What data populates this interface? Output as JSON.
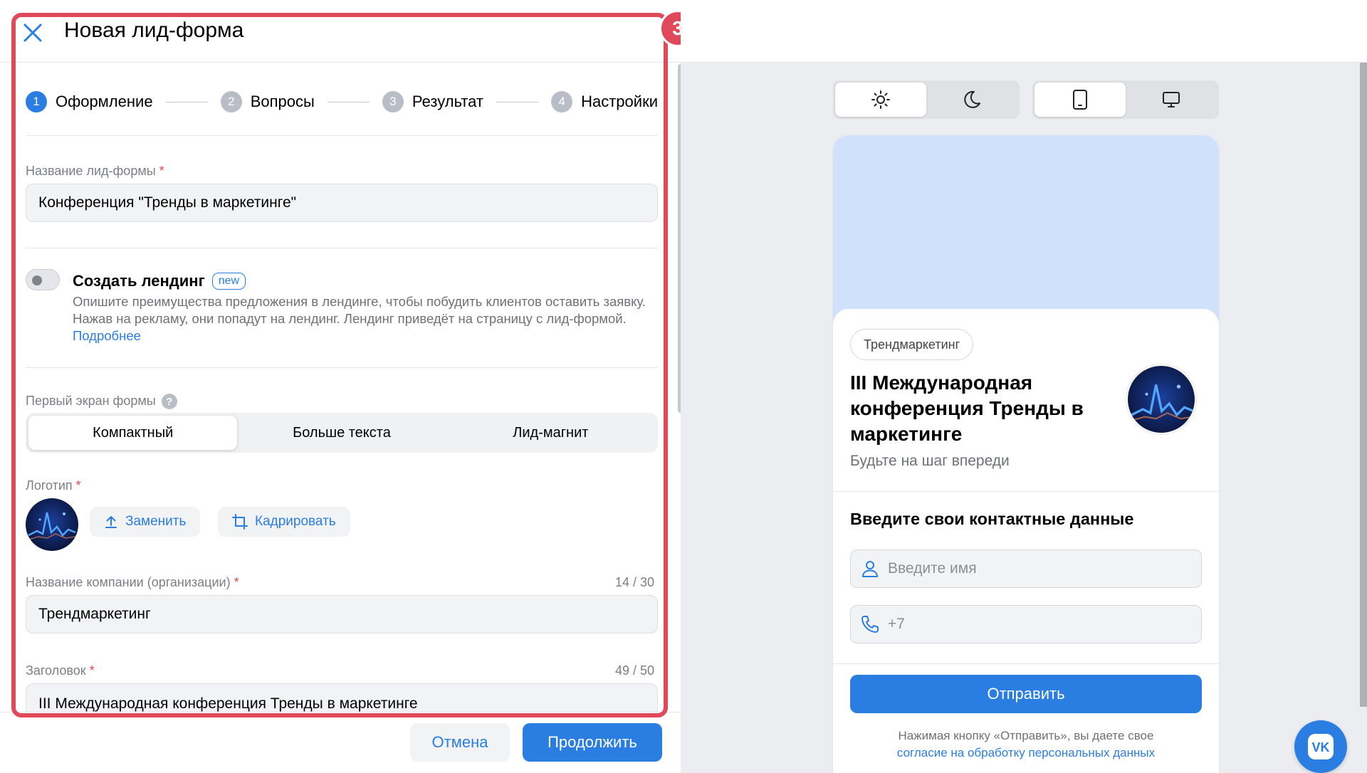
{
  "header": {
    "title": "Новая лид-форма"
  },
  "stepper": {
    "steps": [
      {
        "num": "1",
        "label": "Оформление",
        "active": true
      },
      {
        "num": "2",
        "label": "Вопросы",
        "active": false
      },
      {
        "num": "3",
        "label": "Результат",
        "active": false
      },
      {
        "num": "4",
        "label": "Настройки",
        "active": false
      }
    ]
  },
  "form": {
    "name_label": "Название лид-формы",
    "name_value": "Конференция \"Тренды в маркетинге\"",
    "landing": {
      "title": "Создать лендинг",
      "badge": "new",
      "desc": "Опишите преимущества предложения в лендинге, чтобы побудить клиентов оставить заявку. Нажав на рекламу, они попадут на лендинг. Лендинг приведёт на страницу с лид-формой.",
      "link": "Подробнее"
    },
    "first_screen_label": "Первый экран формы",
    "first_screen_options": [
      "Компактный",
      "Больше текста",
      "Лид-магнит"
    ],
    "first_screen_selected": "Компактный",
    "logo_label": "Логотип",
    "replace_btn": "Заменить",
    "crop_btn": "Кадрировать",
    "company_label": "Название компании (организации)",
    "company_counter": "14 / 30",
    "company_value": "Трендмаркетинг",
    "headline_label": "Заголовок",
    "headline_counter": "49 / 50",
    "headline_value": "III Международная конференция Тренды в маркетинге",
    "required_mark": "*"
  },
  "footer": {
    "cancel": "Отмена",
    "continue": "Продолжить"
  },
  "annotation": {
    "step_number": "3",
    "color": "#e0495a"
  },
  "preview": {
    "chip": "Трендмаркетинг",
    "title": "III Международная конференция Тренды в маркетинге",
    "subtitle": "Будьте на шаг впереди",
    "contact_heading": "Введите свои контактные данные",
    "name_placeholder": "Введите имя",
    "phone_placeholder": "+7",
    "submit": "Отправить",
    "note_prefix": "Нажимая кнопку «Отправить», вы даете свое",
    "note_link": "согласие на обработку персональных данных",
    "cover_color": "#cfe1fb"
  },
  "toolbar": {
    "theme": [
      "sun-icon",
      "moon-icon"
    ],
    "theme_selected": "sun-icon",
    "device": [
      "phone-icon",
      "desktop-icon"
    ],
    "device_selected": "phone-icon"
  },
  "colors": {
    "accent": "#2a7de1",
    "required": "#e64646"
  }
}
